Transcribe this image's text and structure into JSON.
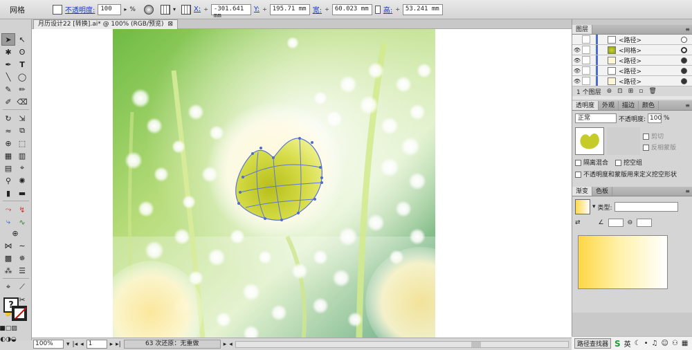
{
  "control_bar": {
    "mode_label": "网格",
    "opacity_label": "不透明度:",
    "opacity_value": "100",
    "opacity_unit": "%",
    "x_label": "X:",
    "x_value": "-301.641 mm",
    "y_label": "Y:",
    "y_value": "195.71 mm",
    "w_label": "宽:",
    "w_value": "60.023 mm",
    "h_label": "高:",
    "h_value": "53.241 mm"
  },
  "document": {
    "tab_title": "月历设计22 [转换].ai* @ 100% (RGB/预览)",
    "close_glyph": "⊠"
  },
  "status_bar": {
    "zoom": "100%",
    "page": "1",
    "info": "63 次还原：无重做"
  },
  "layers_panel": {
    "tab": "图层",
    "rows": [
      {
        "name": "<路径>",
        "thumb": "blank"
      },
      {
        "name": "<网格>",
        "thumb": "mesh"
      },
      {
        "name": "<路径>",
        "thumb": "blank"
      },
      {
        "name": "<路径>",
        "thumb": "blank"
      },
      {
        "name": "<路径>",
        "thumb": "blank"
      }
    ],
    "footer": "1 个图层"
  },
  "transparency_panel": {
    "tabs": [
      "透明度",
      "外观",
      "描边",
      "颜色"
    ],
    "blend_mode": "正常",
    "opacity_label": "不透明度:",
    "opacity_value": "100",
    "opacity_unit": "%",
    "clip_label": "剪切",
    "invert_label": "反相蒙版",
    "isolate_label": "隔离混合",
    "knockout_label": "挖空组",
    "opacity_mask_label": "不透明度和蒙版用来定义挖空形状"
  },
  "gradient_panel": {
    "tabs": [
      "渐变",
      "色板"
    ],
    "type_label": "类型:"
  },
  "taskbar": {
    "search_label": "路径查找器",
    "ime_label": "英",
    "ime_icon": "S"
  },
  "colors": {
    "accent_blue": "#1a3bc6",
    "mesh_line": "#5a76d8",
    "heart_yellow": "#c9cf2e",
    "bg_green_dark": "#3f9a4f",
    "bg_green_light": "#c3e28a"
  }
}
